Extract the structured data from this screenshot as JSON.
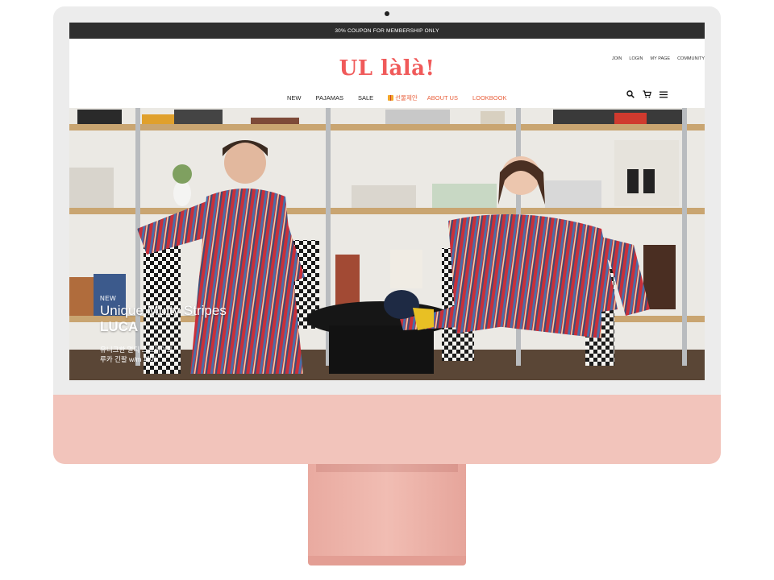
{
  "promo_bar": {
    "text": "30% COUPON FOR MEMBERSHIP ONLY"
  },
  "header": {
    "logo": "UL làlà!",
    "util_links": [
      "JOIN",
      "LOGIN",
      "MY PAGE",
      "COMMUNITY"
    ]
  },
  "nav": {
    "items": [
      "NEW",
      "PAJAMAS",
      "SALE"
    ],
    "gift_label": "선물제안",
    "about": "ABOUT US",
    "lookbook": "LOOKBOOK",
    "accent_color": "#e8603c",
    "icons": [
      "search-icon",
      "cart-icon",
      "menu-icon"
    ]
  },
  "hero": {
    "tag": "NEW",
    "title": "Unique Multy Stripes",
    "name": "LUCA",
    "desc_line1": "유니크한 멀티 스트라이프",
    "desc_line2": "루카 긴팔 w/m 페어"
  },
  "colors": {
    "logo": "#f05a5a",
    "promo_bg": "#2e2e2e",
    "imac_pink": "#f2c4bb"
  }
}
